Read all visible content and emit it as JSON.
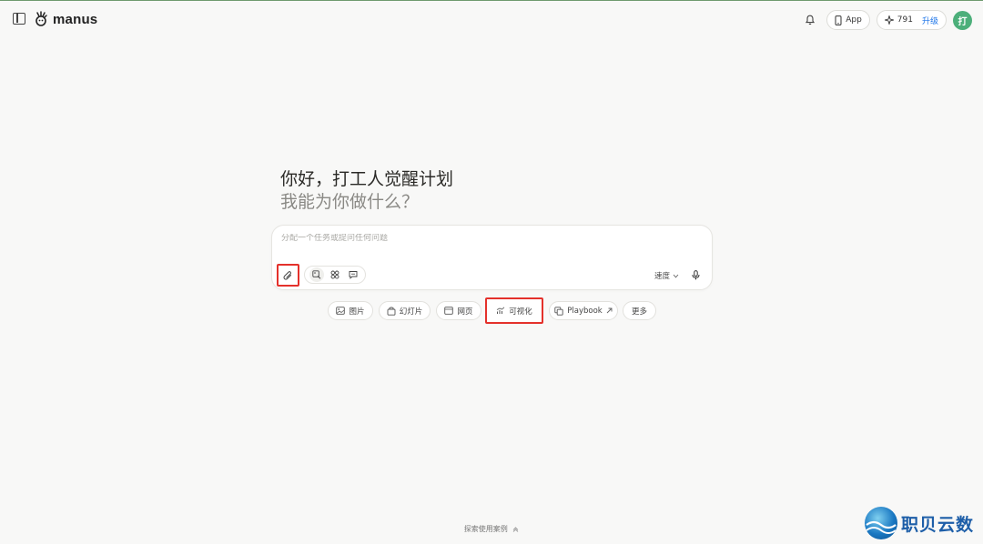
{
  "header": {
    "logo_text": "manus",
    "app_label": "App",
    "credits": "791",
    "upgrade_label": "升级",
    "avatar_initial": "打"
  },
  "greeting": {
    "line1": "你好，打工人觉醒计划",
    "line2": "我能为你做什么？"
  },
  "composer": {
    "placeholder": "分配一个任务或提问任何问题",
    "speed_label": "速度"
  },
  "chips": [
    {
      "label": "图片",
      "icon": "image-icon"
    },
    {
      "label": "幻灯片",
      "icon": "slides-icon"
    },
    {
      "label": "网页",
      "icon": "webpage-icon"
    },
    {
      "label": "可视化",
      "icon": "chart-icon"
    },
    {
      "label": "Playbook",
      "icon": "copy-icon"
    },
    {
      "label": "更多",
      "icon": ""
    }
  ],
  "footer": {
    "explore_label": "探索使用案例"
  },
  "watermark": {
    "text": "职贝云数"
  },
  "colors": {
    "background": "#f8f8f7",
    "accent": "#1a73e8",
    "avatar": "#4caf7a",
    "highlight": "#e4312b"
  }
}
